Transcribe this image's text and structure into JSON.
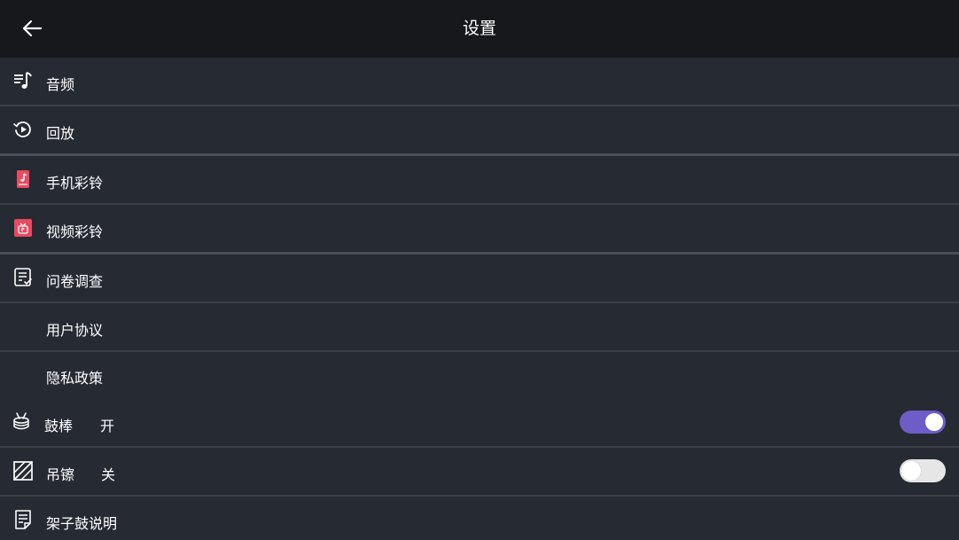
{
  "header": {
    "title": "设置",
    "back_icon": "arrow-left-icon"
  },
  "items": {
    "audio": {
      "label": "音频",
      "icon": "music-note-list-icon"
    },
    "playback": {
      "label": "回放",
      "icon": "replay-circle-icon"
    },
    "phone_ringtone": {
      "label": "手机彩铃",
      "icon": "phone-ringtone-icon"
    },
    "video_ringtone": {
      "label": "视频彩铃",
      "icon": "video-ringtone-icon"
    },
    "survey": {
      "label": "问卷调查",
      "icon": "survey-document-icon"
    },
    "user_agreement": {
      "label": "用户协议"
    },
    "privacy_policy": {
      "label": "隐私政策"
    },
    "drumstick": {
      "label": "鼓棒",
      "state": "开",
      "toggle_on": true,
      "icon": "drum-icon"
    },
    "cymbal": {
      "label": "吊镲",
      "state": "关",
      "toggle_on": false,
      "icon": "hatched-square-icon"
    },
    "drum_kit_info": {
      "label": "架子鼓说明",
      "icon": "document-edit-icon"
    }
  },
  "colors": {
    "background": "#262a33",
    "header": "#16181c",
    "toggle_on": "#6e5cc8",
    "toggle_off": "#e6e6e6",
    "ringtone_accent": "#e84a5f"
  }
}
